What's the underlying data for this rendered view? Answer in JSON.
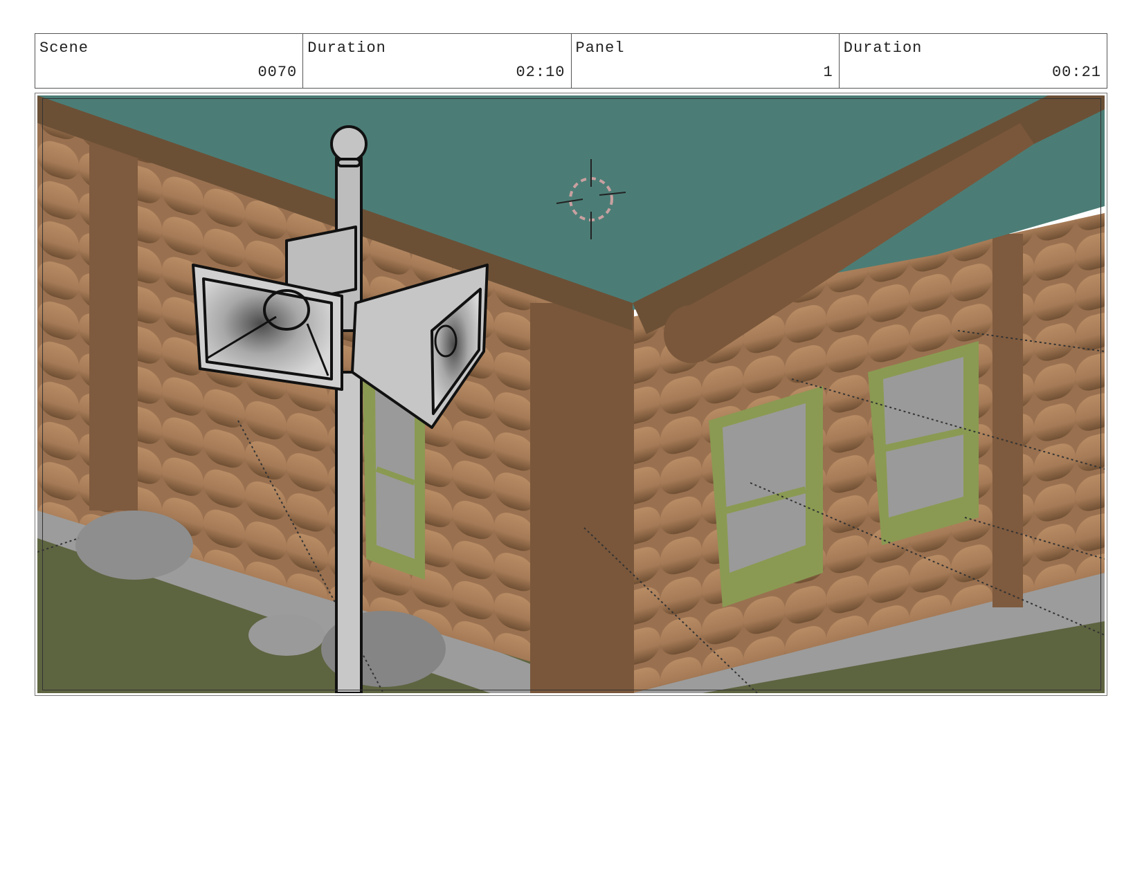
{
  "header": {
    "scene": {
      "label": "Scene",
      "value": "0070"
    },
    "scene_duration": {
      "label": "Duration",
      "value": "02:10"
    },
    "panel": {
      "label": "Panel",
      "value": "1"
    },
    "panel_duration": {
      "label": "Duration",
      "value": "00:21"
    }
  },
  "panel_image": {
    "subject_icons": [
      "log-cabin-icon",
      "loudspeaker-horn-icon",
      "camera-target-icon"
    ],
    "colors": {
      "roof": "#4b7d76",
      "roof_trim": "#6b5036",
      "log": "#a57a56",
      "log_shadow": "#6f4f33",
      "window_trim": "#8a9a52",
      "window_glass": "#9a9a9a",
      "grass": "#5d6440",
      "rock": "#8e8e8e",
      "speaker": "#cfcfcf"
    }
  }
}
